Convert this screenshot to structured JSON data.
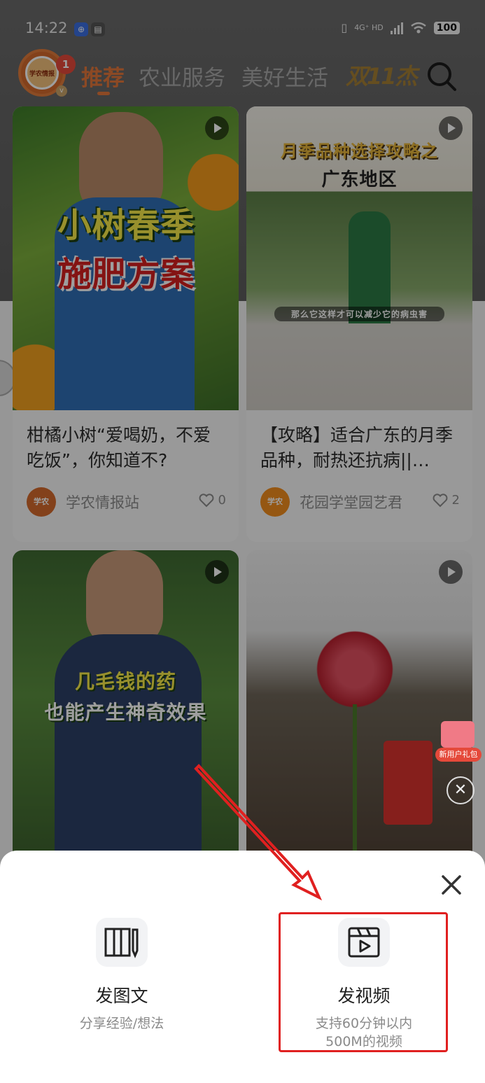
{
  "status_bar": {
    "time": "14:22",
    "network": "4G⁺ HD",
    "battery": "100"
  },
  "header": {
    "avatar_text": "学农情报",
    "notification_count": "1",
    "tabs": [
      {
        "label": "推荐",
        "active": true
      },
      {
        "label": "农业服务",
        "active": false
      },
      {
        "label": "美好生活",
        "active": false
      }
    ],
    "promo_label": "双11杰"
  },
  "feed": {
    "cards": [
      {
        "overlay_lines": [
          "小树春季",
          "施肥方案"
        ],
        "title": "柑橘小树“爱喝奶，不爱吃饭”，你知道不?",
        "author": "学农情报站",
        "author_avatar_text": "学农",
        "likes": "0"
      },
      {
        "overlay_lines": [
          "月季品种选择攻略之",
          "广东地区"
        ],
        "subtitle_caption": "那么它这样才可以减少它的病虫害",
        "title": "【攻略】适合广东的月季品种，耐热还抗病||…",
        "author": "花园学堂园艺君",
        "author_avatar_text": "学农",
        "likes": "2"
      },
      {
        "overlay_lines": [
          "几毛钱的药",
          "也能产生神奇效果"
        ]
      },
      {
        "overlay_lines": []
      }
    ]
  },
  "gift": {
    "label": "新用户礼包"
  },
  "sheet": {
    "options": [
      {
        "title": "发图文",
        "subtitle": "分享经验/想法"
      },
      {
        "title": "发视频",
        "subtitle_line1": "支持60分钟以内",
        "subtitle_line2": "500M的视频"
      }
    ]
  },
  "colors": {
    "accent": "#e2763a",
    "highlight": "#e02020"
  }
}
